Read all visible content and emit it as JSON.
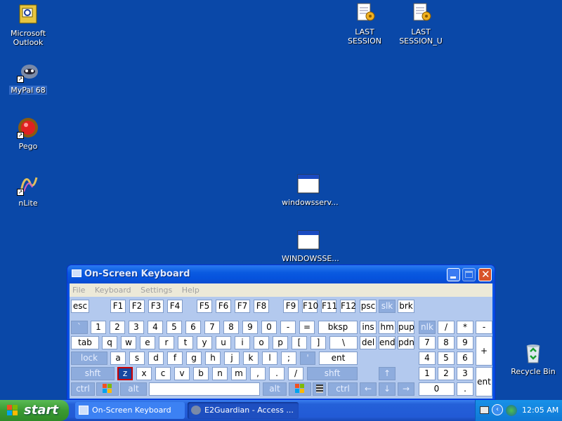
{
  "desktop": {
    "icons": [
      {
        "name": "Microsoft Outlook",
        "line1": "Microsoft",
        "line2": "Outlook"
      },
      {
        "name": "MyPal 68",
        "line1": "MyPal 68"
      },
      {
        "name": "Pego",
        "line1": "Pego"
      },
      {
        "name": "nLite",
        "line1": "nLite"
      },
      {
        "name": "LAST SESSION",
        "line1": "LAST SESSION"
      },
      {
        "name": "LAST SESSION_U",
        "line1": "LAST",
        "line2": "SESSION_U"
      },
      {
        "name": "windowsserv...",
        "line1": "windowsserv..."
      },
      {
        "name": "WINDOWSSE...",
        "line1": "WINDOWSSE..."
      },
      {
        "name": "Recycle Bin",
        "line1": "Recycle Bin"
      }
    ]
  },
  "osk": {
    "title": "On-Screen Keyboard",
    "menu": [
      "File",
      "Keyboard",
      "Settings",
      "Help"
    ],
    "keys": {
      "esc": "esc",
      "f1": "F1",
      "f2": "F2",
      "f3": "F3",
      "f4": "F4",
      "f5": "F5",
      "f6": "F6",
      "f7": "F7",
      "f8": "F8",
      "f9": "F9",
      "f10": "F10",
      "f11": "F11",
      "f12": "F12",
      "psc": "psc",
      "slk": "slk",
      "brk": "brk",
      "grave": "`",
      "n1": "1",
      "n2": "2",
      "n3": "3",
      "n4": "4",
      "n5": "5",
      "n6": "6",
      "n7": "7",
      "n8": "8",
      "n9": "9",
      "n0": "0",
      "minus": "-",
      "eq": "=",
      "bksp": "bksp",
      "ins": "ins",
      "hm": "hm",
      "pup": "pup",
      "nlk": "nlk",
      "div": "/",
      "mul": "*",
      "sub": "-",
      "tab": "tab",
      "q": "q",
      "w": "w",
      "e": "e",
      "r": "r",
      "t": "t",
      "y": "y",
      "u": "u",
      "i": "i",
      "o": "o",
      "p": "p",
      "lb": "[",
      "rb": "]",
      "bs": "\\",
      "del": "del",
      "end": "end",
      "pdn": "pdn",
      "p7": "7",
      "p8": "8",
      "p9": "9",
      "padd": "+",
      "lock": "lock",
      "a": "a",
      "s": "s",
      "d": "d",
      "f": "f",
      "g": "g",
      "h": "h",
      "j": "j",
      "k": "k",
      "l": "l",
      "semi": ";",
      "quote": "'",
      "ent": "ent",
      "p4": "4",
      "p5": "5",
      "p6": "6",
      "lshft": "shft",
      "z": "z",
      "x": "x",
      "c": "c",
      "v": "v",
      "b": "b",
      "n": "n",
      "m": "m",
      "comma": ",",
      "dot": ".",
      "slash": "/",
      "rshft": "shft",
      "up": "↑",
      "p1": "1",
      "p2": "2",
      "p3": "3",
      "pent": "ent",
      "lctrl": "ctrl",
      "lalt": "alt",
      "ralt": "alt",
      "rctrl": "ctrl",
      "left": "←",
      "down": "↓",
      "right": "→",
      "p0": "0",
      "pdot": "."
    }
  },
  "taskbar": {
    "start": "start",
    "tasks": [
      "On-Screen Keyboard",
      "E2Guardian - Access ..."
    ],
    "clock": "12:05 AM"
  }
}
